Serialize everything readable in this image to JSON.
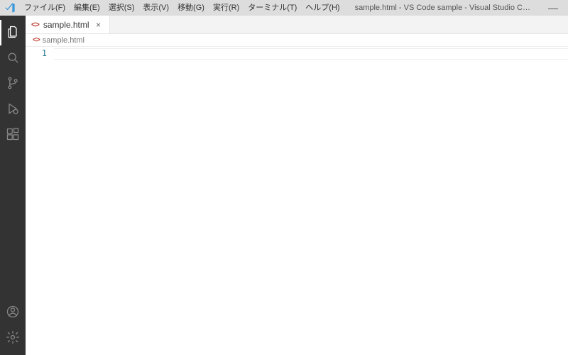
{
  "titlebar": {
    "menus": [
      {
        "label": "ファイル(F)"
      },
      {
        "label": "編集(E)"
      },
      {
        "label": "選択(S)"
      },
      {
        "label": "表示(V)"
      },
      {
        "label": "移動(G)"
      },
      {
        "label": "実行(R)"
      },
      {
        "label": "ターミナル(T)"
      },
      {
        "label": "ヘルプ(H)"
      }
    ],
    "title": "sample.html - VS Code sample - Visual Studio C…",
    "minimize": "—"
  },
  "tabs": {
    "active": {
      "filename": "sample.html",
      "close": "×"
    }
  },
  "breadcrumbs": {
    "filename": "sample.html"
  },
  "editor": {
    "line_number": "1",
    "content": ""
  }
}
